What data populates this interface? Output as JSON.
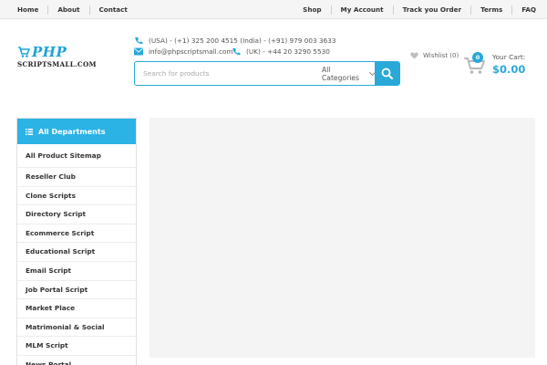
{
  "top_nav_left": [
    {
      "label": "Home"
    },
    {
      "label": "About"
    },
    {
      "label": "Contact"
    }
  ],
  "top_nav_right": [
    {
      "label": "Shop"
    },
    {
      "label": "My Account"
    },
    {
      "label": "Track you Order"
    },
    {
      "label": "Terms"
    },
    {
      "label": "FAQ"
    }
  ],
  "logo": {
    "main": "PHP",
    "sub": "SCRIPTSMALL.COM"
  },
  "contact": {
    "phone_primary": "(USA) - (+1) 325 200 4515 (India) - (+91) 979 003 3633",
    "email": "info@phpscriptsmall.com",
    "phone_uk": "(UK) - +44 20 3290 5530"
  },
  "search": {
    "placeholder": "Search for products",
    "category": "All Categories"
  },
  "wishlist": {
    "label": "Wishlist (0)"
  },
  "cart": {
    "count": "0",
    "label": "Your Cart:",
    "total": "$0.00"
  },
  "departments": {
    "title": "All Departments",
    "items": [
      {
        "label": "All Product Sitemap"
      },
      {
        "label": "Reseller Club"
      },
      {
        "label": "Clone Scripts"
      },
      {
        "label": "Directory Script"
      },
      {
        "label": "Ecommerce Script"
      },
      {
        "label": "Educational Script"
      },
      {
        "label": "Email Script"
      },
      {
        "label": "Job Portal Script"
      },
      {
        "label": "Market Place"
      },
      {
        "label": "Matrimonial & Social"
      },
      {
        "label": "MLM Script"
      },
      {
        "label": "News Portal"
      }
    ]
  },
  "colors": {
    "accent": "#2aa9d9",
    "dept_header": "#2bb3e6",
    "banner_bg": "#f4f4f4"
  },
  "icons": {
    "phone": "phone-icon",
    "email": "envelope-icon",
    "search": "search-icon",
    "wishlist": "heart-icon",
    "cart": "cart-icon",
    "departments": "list-icon"
  }
}
